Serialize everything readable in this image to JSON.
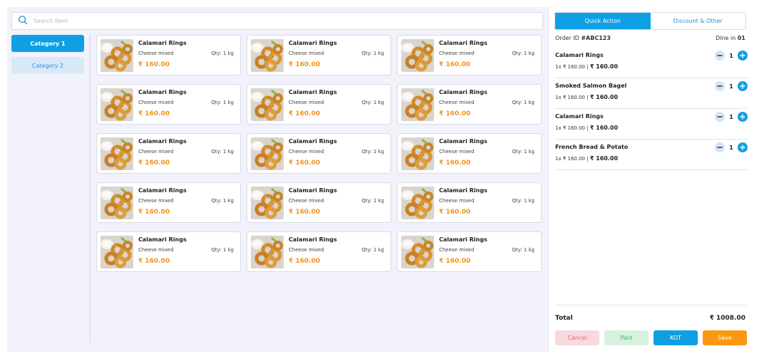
{
  "search": {
    "placeholder": "Search Item",
    "value": ""
  },
  "categories": [
    {
      "label": "Category 1",
      "active": true
    },
    {
      "label": "Category 2",
      "active": false
    }
  ],
  "products": [
    {
      "name": "Calamari Rings",
      "description": "Cheese mixed",
      "qty": "Qty: 1 kg",
      "price": "₹ 160.00"
    },
    {
      "name": "Calamari Rings",
      "description": "Cheese mixed",
      "qty": "Qty: 1 kg",
      "price": "₹ 160.00"
    },
    {
      "name": "Calamari Rings",
      "description": "Cheese mixed",
      "qty": "Qty: 1 kg",
      "price": "₹ 160.00"
    },
    {
      "name": "Calamari Rings",
      "description": "Cheese mixed",
      "qty": "Qty: 1 kg",
      "price": "₹ 160.00"
    },
    {
      "name": "Calamari Rings",
      "description": "Cheese mixed",
      "qty": "Qty: 1 kg",
      "price": "₹ 160.00"
    },
    {
      "name": "Calamari Rings",
      "description": "Cheese mixed",
      "qty": "Qty: 1 kg",
      "price": "₹ 160.00"
    },
    {
      "name": "Calamari Rings",
      "description": "Cheese mixed",
      "qty": "Qty: 1 kg",
      "price": "₹ 160.00"
    },
    {
      "name": "Calamari Rings",
      "description": "Cheese mixed",
      "qty": "Qty: 1 kg",
      "price": "₹ 160.00"
    },
    {
      "name": "Calamari Rings",
      "description": "Cheese mixed",
      "qty": "Qty: 1 kg",
      "price": "₹ 160.00"
    },
    {
      "name": "Calamari Rings",
      "description": "Cheese mixed",
      "qty": "Qty: 1 kg",
      "price": "₹ 160.00"
    },
    {
      "name": "Calamari Rings",
      "description": "Cheese mixed",
      "qty": "Qty: 1 kg",
      "price": "₹ 160.00"
    },
    {
      "name": "Calamari Rings",
      "description": "Cheese mixed",
      "qty": "Qty: 1 kg",
      "price": "₹ 160.00"
    },
    {
      "name": "Calamari Rings",
      "description": "Cheese mixed",
      "qty": "Qty: 1 kg",
      "price": "₹ 160.00"
    },
    {
      "name": "Calamari Rings",
      "description": "Cheese mixed",
      "qty": "Qty: 1 kg",
      "price": "₹ 160.00"
    },
    {
      "name": "Calamari Rings",
      "description": "Cheese mixed",
      "qty": "Qty: 1 kg",
      "price": "₹ 160.00"
    }
  ],
  "tabs": [
    {
      "label": "Quick Action",
      "active": true
    },
    {
      "label": "Discount & Other",
      "active": false
    }
  ],
  "order": {
    "id_label": "Order ID",
    "id_value": "#ABC123",
    "dine_label": "Dine in",
    "dine_value": "01",
    "items": [
      {
        "name": "Calamari Rings",
        "qty": "1",
        "line": "1x ₹ 160.00 |",
        "line_total": "₹ 160.00"
      },
      {
        "name": "Smoked Salmon Bagel",
        "qty": "1",
        "line": "1x ₹ 160.00 |",
        "line_total": "₹ 160.00"
      },
      {
        "name": "Calamari Rings",
        "qty": "1",
        "line": "1x ₹ 160.00 |",
        "line_total": "₹ 160.00"
      },
      {
        "name": "French Bread & Potato",
        "qty": "1",
        "line": "1x ₹ 160.00 |",
        "line_total": "₹ 160.00"
      }
    ],
    "total_label": "Total",
    "total_value": "₹ 1008.00"
  },
  "actions": {
    "cancel": "Cancel",
    "paid": "Paid",
    "kot": "KOT",
    "save": "Save"
  },
  "colors": {
    "primary": "#0ea0e3",
    "price": "#f39219",
    "save": "#fb9813",
    "cancel_bg": "#f8d9de",
    "paid_bg": "#d6f2de"
  }
}
